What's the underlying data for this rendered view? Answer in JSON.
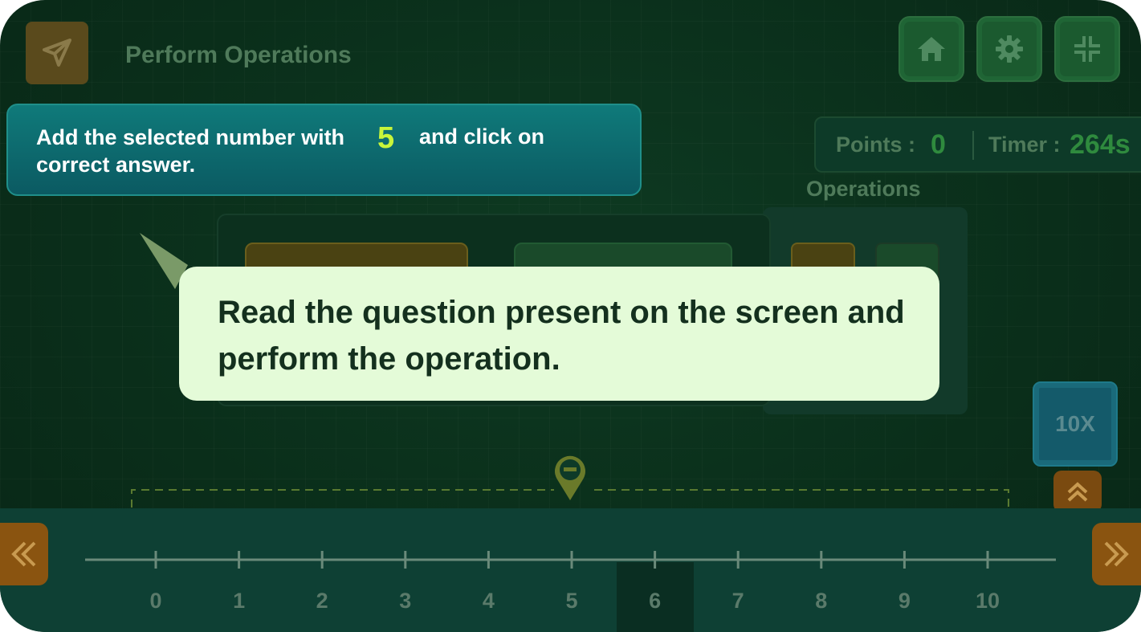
{
  "header": {
    "title": "Perform Operations"
  },
  "question": {
    "text_before": "Add the selected number with",
    "number": "5",
    "text_after": "and click on",
    "text_line2": "correct answer."
  },
  "stats": {
    "points_label": "Points :",
    "points_value": "0",
    "timer_label": "Timer :",
    "timer_value": "264s"
  },
  "operations": {
    "label": "Operations"
  },
  "tooltip": {
    "text": "Read the question present on the screen and perform the operation."
  },
  "controls": {
    "zoom_label": "10X"
  },
  "number_line": {
    "ticks": [
      "0",
      "1",
      "2",
      "3",
      "4",
      "5",
      "6",
      "7",
      "8",
      "9",
      "10"
    ],
    "selected_value": 6,
    "marker_value": 5
  },
  "icons": {
    "back": "paper-plane-icon",
    "home": "home-icon",
    "settings": "gear-icon",
    "fullscreen": "compress-icon",
    "zoom_up": "chevron-double-up-icon",
    "nav_left": "chevron-double-left-icon",
    "nav_right": "chevron-double-right-icon",
    "marker": "minus-pin-icon"
  },
  "colors": {
    "accent_number": "#c8f53a",
    "tooltip_bg": "#e4fbd8",
    "question_bg": "#0b5a62"
  }
}
